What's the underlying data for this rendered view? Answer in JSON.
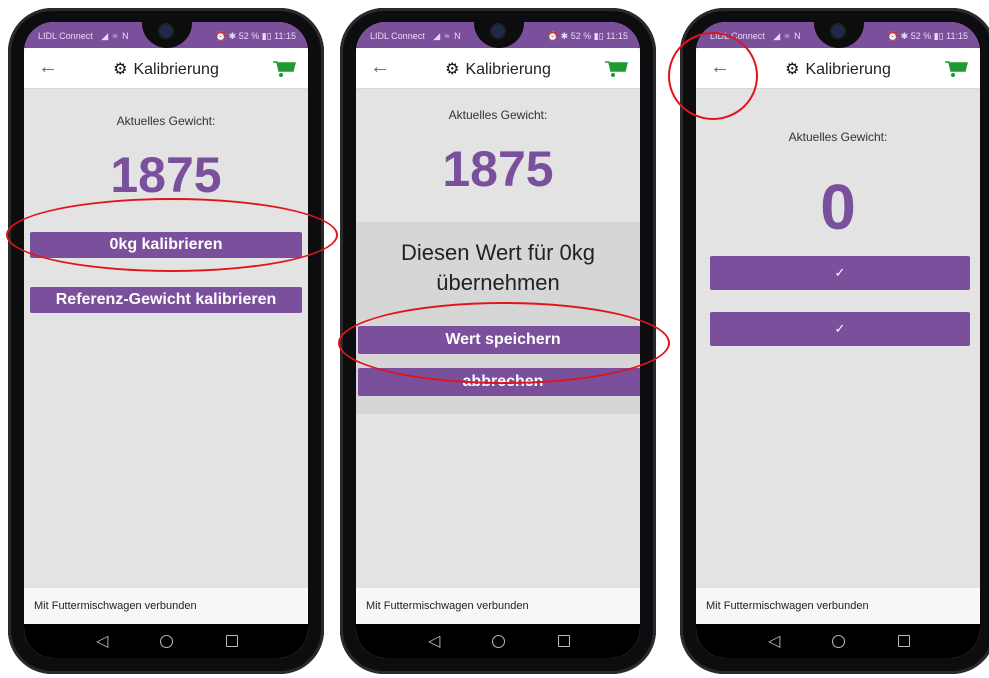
{
  "screens": [
    {
      "status": {
        "carrier": "LIDL Connect",
        "signal_icons": "◢ ≈ N",
        "right": "⏰ ✱ 52 % ▮▯ 11:15"
      },
      "appbar": {
        "title": "Kalibrierung"
      },
      "weight_label": "Aktuelles Gewicht:",
      "weight_value": "1875",
      "buttons": [
        "0kg kalibrieren",
        "Referenz-Gewicht kalibrieren"
      ],
      "footer": "Mit Futtermischwagen verbunden"
    },
    {
      "status": {
        "carrier": "LIDL Connect",
        "signal_icons": "◢ ≈ N",
        "right": "⏰ ✱ 52 % ▮▯ 11:15"
      },
      "appbar": {
        "title": "Kalibrierung"
      },
      "weight_label": "Aktuelles Gewicht:",
      "weight_value": "1875",
      "dialog": {
        "line1": "Diesen Wert für 0kg",
        "line2": "übernehmen",
        "save": "Wert speichern",
        "cancel": "abbrechen"
      },
      "footer": "Mit Futtermischwagen verbunden"
    },
    {
      "status": {
        "carrier": "LIDL Connect",
        "signal_icons": "◢ ≈ N",
        "right": "⏰ ✱ 52 % ▮▯ 11:15"
      },
      "appbar": {
        "title": "Kalibrierung"
      },
      "weight_label": "Aktuelles Gewicht:",
      "weight_value": "0",
      "buttons": [
        "✓",
        "✓"
      ],
      "footer": "Mit Futtermischwagen verbunden"
    }
  ],
  "icons": {
    "back": "←",
    "settings": "⚙",
    "nav_back": "◁"
  },
  "colors": {
    "accent": "#7a4f9c",
    "cart": "#1e9a2e",
    "highlight": "#e0141b"
  }
}
